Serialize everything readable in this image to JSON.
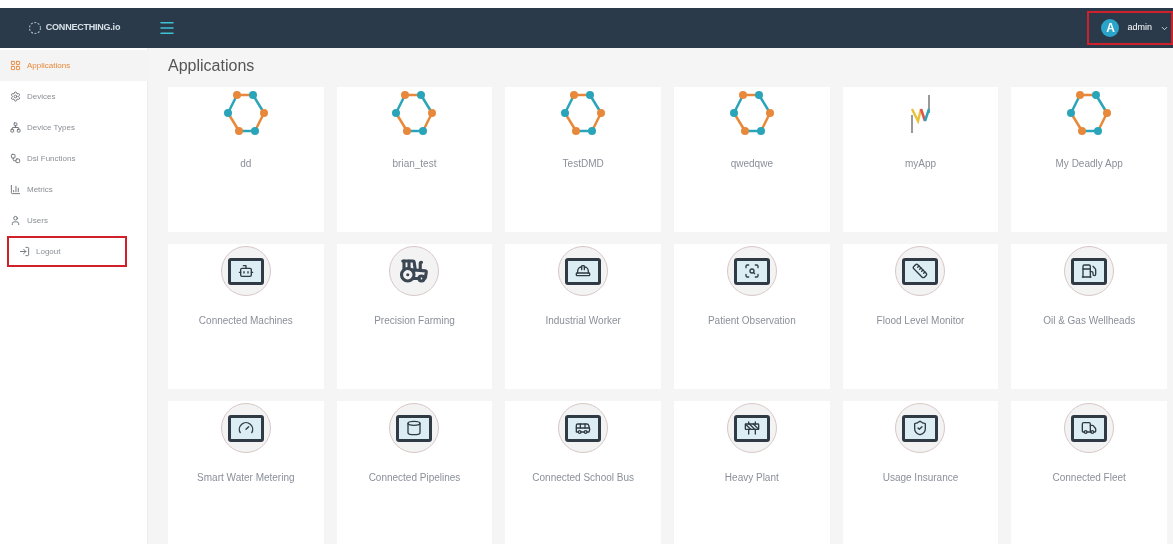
{
  "header": {
    "logo": "CONNECTHING.io",
    "user": {
      "initial": "A",
      "name": "admin",
      "highlighted": true
    }
  },
  "sidebar": {
    "items": [
      {
        "label": "Applications",
        "selected": true,
        "highlighted": false
      },
      {
        "label": "Devices",
        "selected": false,
        "highlighted": false
      },
      {
        "label": "Device Types",
        "selected": false,
        "highlighted": false
      },
      {
        "label": "Dsl Functions",
        "selected": false,
        "highlighted": false
      },
      {
        "label": "Metrics",
        "selected": false,
        "highlighted": false
      },
      {
        "label": "Users",
        "selected": false,
        "highlighted": false
      },
      {
        "label": "Logout",
        "selected": false,
        "highlighted": true
      }
    ]
  },
  "page_title": "Applications",
  "apps": [
    {
      "name": "dd",
      "kind": "hexagon"
    },
    {
      "name": "brian_test",
      "kind": "hexagon"
    },
    {
      "name": "TestDMD",
      "kind": "hexagon"
    },
    {
      "name": "qwedqwe",
      "kind": "hexagon"
    },
    {
      "name": "myApp",
      "kind": "zigzag"
    },
    {
      "name": "My Deadly App",
      "kind": "hexagon"
    },
    {
      "name": "Connected Machines",
      "kind": "tablet"
    },
    {
      "name": "Precision Farming",
      "kind": "plain"
    },
    {
      "name": "Industrial Worker",
      "kind": "tablet"
    },
    {
      "name": "Patient Observation",
      "kind": "tablet"
    },
    {
      "name": "Flood Level Monitor",
      "kind": "tablet"
    },
    {
      "name": "Oil & Gas Wellheads",
      "kind": "tablet"
    },
    {
      "name": "Smart Water Metering",
      "kind": "tablet"
    },
    {
      "name": "Connected Pipelines",
      "kind": "tablet"
    },
    {
      "name": "Connected School Bus",
      "kind": "tablet"
    },
    {
      "name": "Heavy Plant",
      "kind": "tablet"
    },
    {
      "name": "Usage Insurance",
      "kind": "tablet"
    },
    {
      "name": "Connected Fleet",
      "kind": "tablet"
    }
  ]
}
